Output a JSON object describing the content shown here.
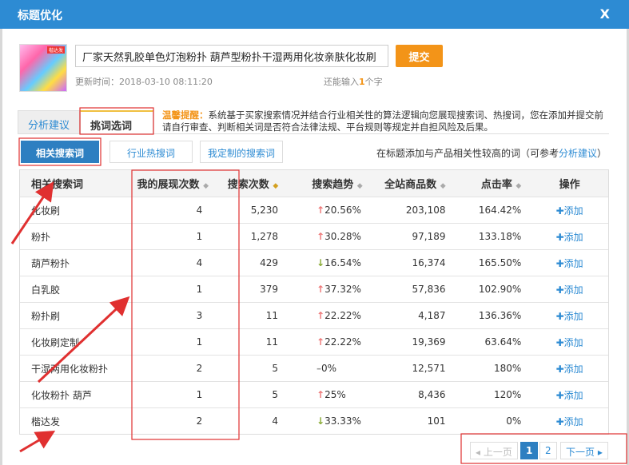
{
  "dialog": {
    "title": "标题优化",
    "close": "X"
  },
  "product": {
    "thumb_badge": "楷达发",
    "title_value": "厂家天然乳胶单色灯泡粉扑 葫芦型粉扑干湿两用化妆亲肤化妆刷",
    "submit": "提交",
    "update_time": "更新时间：2018-03-10 08:11:20",
    "remain_prefix": "还能输入",
    "remain_count": "1",
    "remain_suffix": "个字"
  },
  "tabs": [
    {
      "label": "分析建议",
      "active": false
    },
    {
      "label": "挑词选词",
      "active": true
    }
  ],
  "tip": {
    "label": "温馨提醒：",
    "text": "系统基于买家搜索情况并结合行业相关性的算法逻辑向您展现搜索词、热搜词，您在添加并提交前请自行审查、判断相关词是否符合法律法规、平台规则等规定并自担风险及后果。"
  },
  "subtabs": [
    {
      "label": "相关搜索词",
      "active": true
    },
    {
      "label": "行业热搜词"
    },
    {
      "label": "我定制的搜索词"
    }
  ],
  "hint": {
    "text": "在标题添加与产品相关性较高的词（可参考",
    "link": "分析建议",
    "close": "）"
  },
  "table": {
    "headers": [
      "相关搜索词",
      "我的展现次数",
      "搜索次数",
      "搜索趋势",
      "全站商品数",
      "点击率",
      "操作"
    ],
    "rows": [
      {
        "word": "化妆刷",
        "mine": "4",
        "search": "5,230",
        "trend_dir": "up",
        "trend": "20.56%",
        "total": "203,108",
        "ctr": "164.42%",
        "op": "添加"
      },
      {
        "word": "粉扑",
        "mine": "1",
        "search": "1,278",
        "trend_dir": "up",
        "trend": "30.28%",
        "total": "97,189",
        "ctr": "133.18%",
        "op": "添加"
      },
      {
        "word": "葫芦粉扑",
        "mine": "4",
        "search": "429",
        "trend_dir": "down",
        "trend": "16.54%",
        "total": "16,374",
        "ctr": "165.50%",
        "op": "添加"
      },
      {
        "word": "白乳胶",
        "mine": "1",
        "search": "379",
        "trend_dir": "up",
        "trend": "37.32%",
        "total": "57,836",
        "ctr": "102.90%",
        "op": "添加"
      },
      {
        "word": "粉扑刷",
        "mine": "3",
        "search": "11",
        "trend_dir": "up",
        "trend": "22.22%",
        "total": "4,187",
        "ctr": "136.36%",
        "op": "添加"
      },
      {
        "word": "化妆刷定制",
        "mine": "1",
        "search": "11",
        "trend_dir": "up",
        "trend": "22.22%",
        "total": "19,369",
        "ctr": "63.64%",
        "op": "添加"
      },
      {
        "word": "干湿两用化妆粉扑",
        "mine": "2",
        "search": "5",
        "trend_dir": "flat",
        "trend": "0%",
        "total": "12,571",
        "ctr": "180%",
        "op": "添加"
      },
      {
        "word": "化妆粉扑 葫芦",
        "mine": "1",
        "search": "5",
        "trend_dir": "up",
        "trend": "25%",
        "total": "8,436",
        "ctr": "120%",
        "op": "添加"
      },
      {
        "word": "楷达发",
        "mine": "2",
        "search": "4",
        "trend_dir": "down",
        "trend": "33.33%",
        "total": "101",
        "ctr": "0%",
        "op": "添加"
      }
    ]
  },
  "pagination": {
    "prev": "上一页",
    "pages": [
      "1",
      "2"
    ],
    "current": "1",
    "next": "下一页"
  },
  "colors": {
    "header": "#2d8bd3",
    "submit": "#f39418",
    "annotation": "#e03030",
    "up": "#e77777",
    "down": "#88aa33"
  }
}
